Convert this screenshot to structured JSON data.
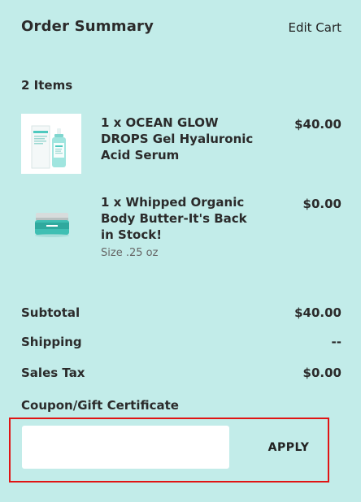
{
  "header": {
    "title": "Order Summary",
    "edit_cart_label": "Edit Cart"
  },
  "cart": {
    "item_count_label": "2 Items",
    "items": [
      {
        "name": "1 x OCEAN GLOW DROPS Gel Hyaluronic Acid Serum",
        "price": "$40.00",
        "image": "serum-bottle-image",
        "label_on_product": "GLOWY"
      },
      {
        "name": "1 x Whipped Organic Body Butter-It's Back in Stock!",
        "price": "$0.00",
        "option": "Size .25 oz",
        "image": "body-butter-jar-image",
        "label_on_product": "WHIPPED"
      }
    ]
  },
  "totals": {
    "subtotal_label": "Subtotal",
    "subtotal_value": "$40.00",
    "shipping_label": "Shipping",
    "shipping_value": "--",
    "tax_label": "Sales Tax",
    "tax_value": "$0.00"
  },
  "coupon": {
    "label": "Coupon/Gift Certificate",
    "input_value": "",
    "apply_label": "APPLY",
    "highlight_color": "#e01414"
  },
  "colors": {
    "background": "#c2ece9",
    "accent": "#4ec9bf"
  }
}
